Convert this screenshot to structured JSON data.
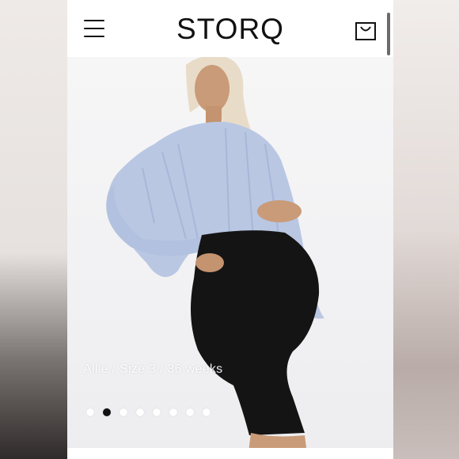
{
  "header": {
    "brand": "STORQ",
    "menu_icon": "hamburger-menu-icon",
    "cart_icon": "shopping-bag-icon"
  },
  "hero": {
    "caption": "Allie / Size 3 / 36 weeks",
    "carousel": {
      "total_slides": 8,
      "active_index": 2
    }
  },
  "colors": {
    "text": "#111111",
    "background": "#ffffff",
    "active_dot": "#111111",
    "inactive_dot": "#ffffff"
  }
}
